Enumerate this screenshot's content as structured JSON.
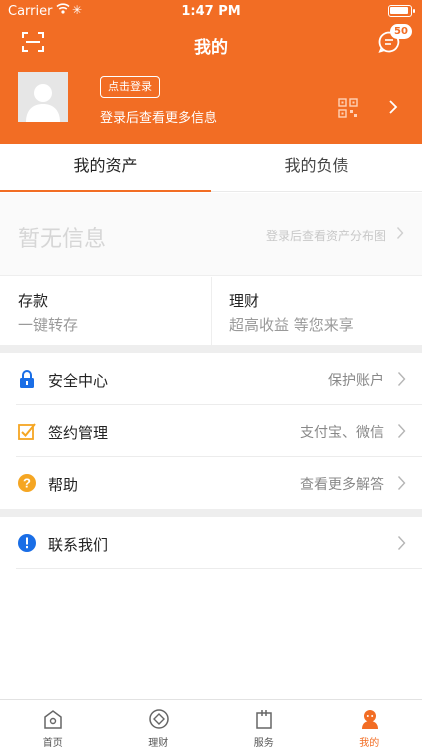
{
  "status_bar": {
    "carrier": "Carrier",
    "time": "1:47 PM"
  },
  "header": {
    "title": "我的",
    "message_badge": "50",
    "login_button": "点击登录",
    "login_hint": "登录后查看更多信息"
  },
  "tabs": {
    "assets": "我的资产",
    "liabilities": "我的负债"
  },
  "empty": {
    "text": "暂无信息",
    "hint": "登录后查看资产分布图"
  },
  "quick": {
    "deposit": {
      "title": "存款",
      "sub": "一键转存"
    },
    "wealth": {
      "title": "理财",
      "sub": "超高收益 等您来享"
    }
  },
  "menu": [
    {
      "label": "安全中心",
      "value": "保护账户"
    },
    {
      "label": "签约管理",
      "value": "支付宝、微信"
    },
    {
      "label": "帮助",
      "value": "查看更多解答"
    },
    {
      "label": "联系我们",
      "value": ""
    }
  ],
  "tabbar": [
    {
      "label": "首页"
    },
    {
      "label": "理财"
    },
    {
      "label": "服务"
    },
    {
      "label": "我的"
    }
  ],
  "colors": {
    "brand": "#f26d24",
    "lock": "#1a6ee6",
    "help": "#f5a623",
    "sign": "#f5a623",
    "contact": "#1a6ee6"
  }
}
